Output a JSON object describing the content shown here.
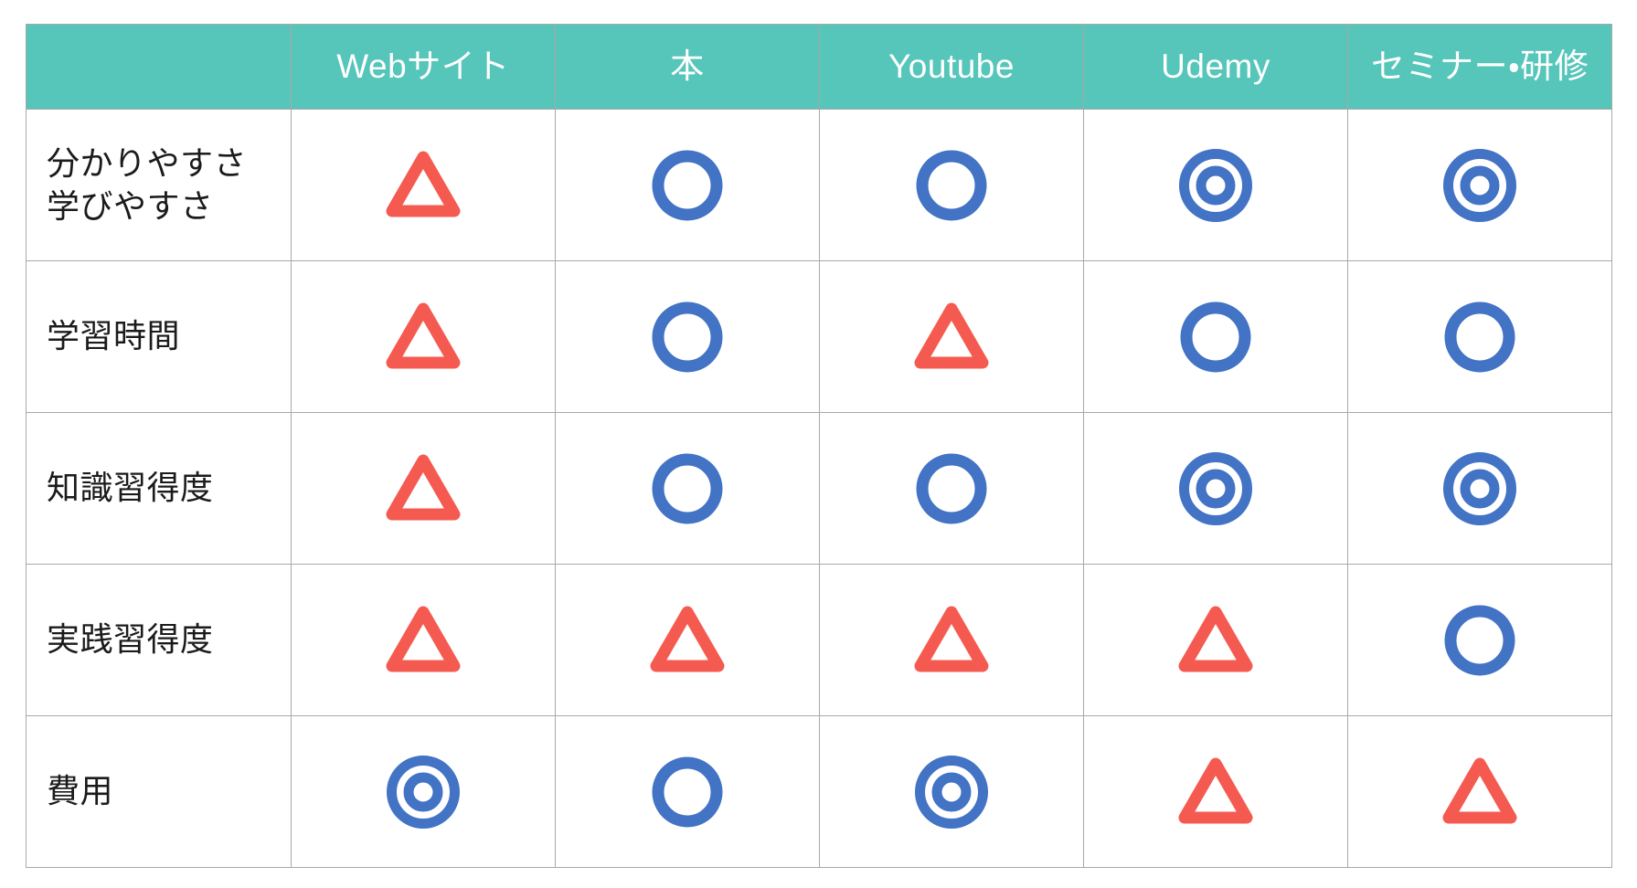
{
  "table": {
    "corner_label": "",
    "columns": [
      {
        "key": "website",
        "label": "Webサイト"
      },
      {
        "key": "book",
        "label": "本"
      },
      {
        "key": "youtube",
        "label": "Youtube"
      },
      {
        "key": "udemy",
        "label": "Udemy"
      },
      {
        "key": "seminar",
        "label": "セミナー・研修"
      }
    ],
    "rows": [
      {
        "key": "understandability",
        "label": "分かりやすさ\n学びやすさ",
        "marks": [
          "triangle",
          "circle",
          "circle",
          "double-circle",
          "double-circle"
        ]
      },
      {
        "key": "study-time",
        "label": "学習時間",
        "marks": [
          "triangle",
          "circle",
          "triangle",
          "circle",
          "circle"
        ]
      },
      {
        "key": "knowledge-acquisition",
        "label": "知識習得度",
        "marks": [
          "triangle",
          "circle",
          "circle",
          "double-circle",
          "double-circle"
        ]
      },
      {
        "key": "practical-acquisition",
        "label": "実践習得度",
        "marks": [
          "triangle",
          "triangle",
          "triangle",
          "triangle",
          "circle"
        ]
      },
      {
        "key": "cost",
        "label": "費用",
        "marks": [
          "double-circle",
          "circle",
          "double-circle",
          "triangle",
          "triangle"
        ]
      }
    ]
  },
  "legend": {
    "double-circle": "◎",
    "circle": "○",
    "triangle": "△"
  },
  "colors": {
    "header_background": "#56c5ba",
    "header_text": "#ffffff",
    "grid_border": "#a8a8a8",
    "circle_blue": "#4273c4",
    "triangle_red": "#f55a51",
    "body_background": "#ffffff",
    "label_text": "#1b1b1b"
  }
}
